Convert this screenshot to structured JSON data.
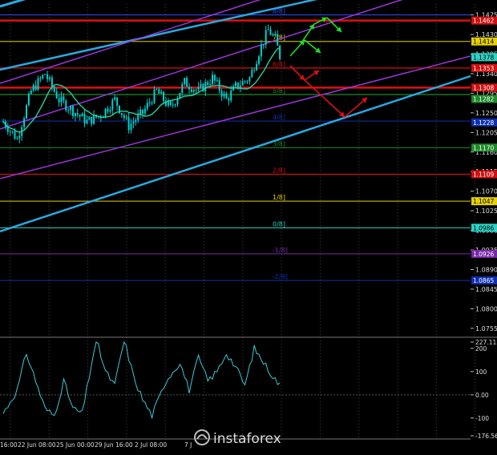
{
  "chart_data": {
    "type": "line",
    "title": "",
    "price_axis": {
      "ticks": [
        "1.1475",
        "1.1430",
        "1.1385",
        "1.1340",
        "1.1295",
        "1.1250",
        "1.1205",
        "1.1160",
        "1.1115",
        "1.1070",
        "1.1025",
        "1.0980",
        "1.0935",
        "1.0890",
        "1.0845",
        "1.0800",
        "1.0755"
      ],
      "ylim": [
        1.074,
        1.15
      ]
    },
    "x_labels": [
      "16:00",
      "22 Jun 08:00",
      "25 Jun 00:00",
      "29 Jun 16:00",
      "2 Jul 08:00",
      "7 J"
    ],
    "price_badges": [
      {
        "value": 1.1462,
        "text": "1.1462",
        "color": "#d01010"
      },
      {
        "value": 1.1414,
        "text": "1.1414",
        "color": "#e6d200"
      },
      {
        "value": 1.1378,
        "text": "1.1378",
        "color": "#2bd4c6"
      },
      {
        "value": 1.1353,
        "text": "1.1353",
        "color": "#d01010"
      },
      {
        "value": 1.1308,
        "text": "1.1308",
        "color": "#d01010"
      },
      {
        "value": 1.1282,
        "text": "1.1282",
        "color": "#1f8a2a"
      },
      {
        "value": 1.1228,
        "text": "1.1228",
        "color": "#1030b0"
      },
      {
        "value": 1.117,
        "text": "1.1170",
        "color": "#1f8a2a"
      },
      {
        "value": 1.1109,
        "text": "1.1109",
        "color": "#d01010"
      },
      {
        "value": 1.1047,
        "text": "1.1047",
        "color": "#e6d200"
      },
      {
        "value": 1.0986,
        "text": "1.0986",
        "color": "#2bd4c6"
      },
      {
        "value": 1.0926,
        "text": "1.0926",
        "color": "#7a2aa8"
      },
      {
        "value": 1.0865,
        "text": "1.0865",
        "color": "#1030b0"
      }
    ],
    "murrey_levels": [
      {
        "value": 1.1475,
        "label": "8/8]",
        "color": "#3050ff"
      },
      {
        "value": 1.1414,
        "label": "7/8]",
        "color": "#e6d200"
      },
      {
        "value": 1.1353,
        "label": "6/8]",
        "color": "#d01010"
      },
      {
        "value": 1.1292,
        "label": "5/8]",
        "color": "#1f8a2a"
      },
      {
        "value": 1.1231,
        "label": "4/8]",
        "color": "#1030b0"
      },
      {
        "value": 1.117,
        "label": "3/8]",
        "color": "#1f8a2a"
      },
      {
        "value": 1.1109,
        "label": "2/8]",
        "color": "#d01010"
      },
      {
        "value": 1.1047,
        "label": "1/8]",
        "color": "#e6d200"
      },
      {
        "value": 1.0986,
        "label": "0/8]",
        "color": "#2bd4c6"
      },
      {
        "value": 1.0926,
        "label": "-1/8]",
        "color": "#7a2aa8"
      },
      {
        "value": 1.0865,
        "label": "-2/8]",
        "color": "#1030b0"
      }
    ],
    "indicator": {
      "ticks": [
        "227.1133",
        "200",
        "100",
        "0.00",
        "-100",
        "-176.5666"
      ],
      "ylim": [
        -176.5666,
        227.1133
      ],
      "zero_line": 0
    },
    "watermark": "instaforex",
    "colors": {
      "background": "#000000",
      "candle_up": "#00d0d0",
      "candle_down": "#00d0d0",
      "moving_average": "#20d4a0",
      "channel_cyan": "#29a9e0",
      "channel_purple": "#9a36d8",
      "arrow_green": "#22dd22",
      "arrow_red": "#dd1111",
      "indicator_line": "#3cc8d8"
    }
  }
}
